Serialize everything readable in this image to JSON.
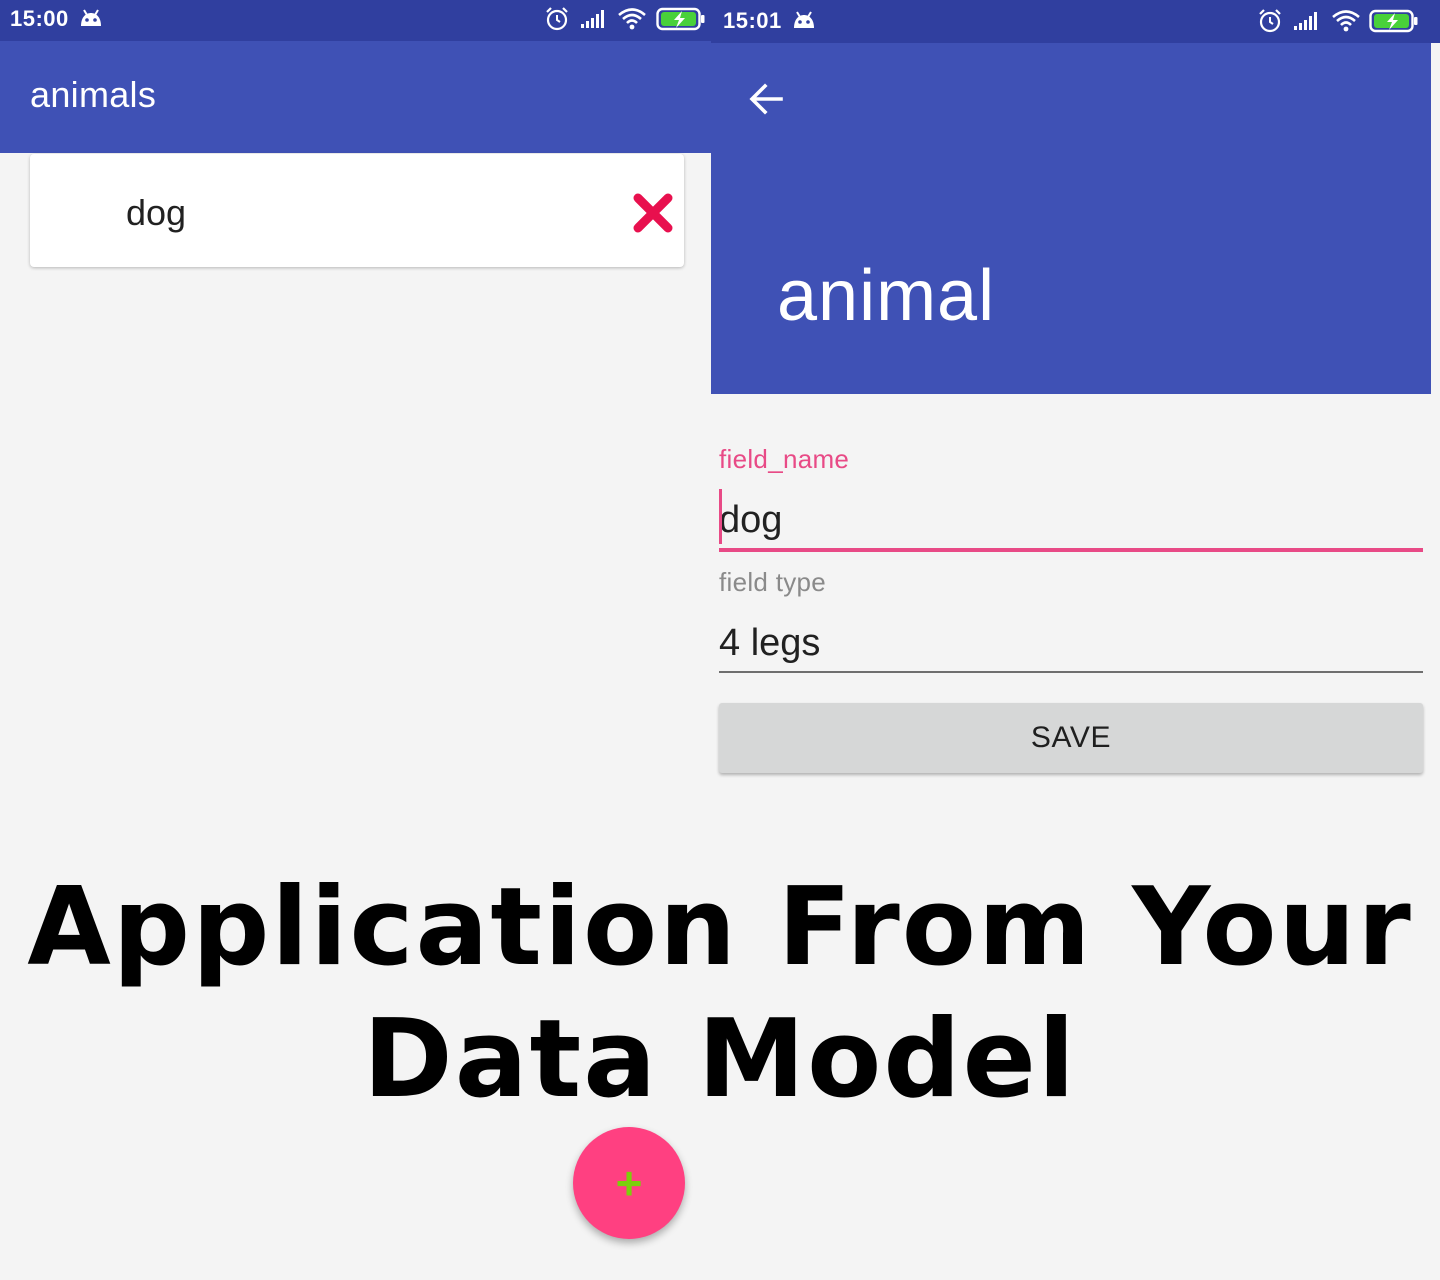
{
  "left_screen": {
    "status_bar": {
      "time": "15:00"
    },
    "app_bar": {
      "title": "animals"
    },
    "list": {
      "items": [
        {
          "label": "dog"
        }
      ]
    },
    "fab": {
      "label": "+"
    }
  },
  "right_screen": {
    "status_bar": {
      "time": "15:01"
    },
    "app_bar": {
      "title": "animal"
    },
    "form": {
      "name_field": {
        "label": "field_name",
        "value": "dog"
      },
      "type_field": {
        "label": "field type",
        "value": "4 legs"
      },
      "save_label": "SAVE"
    }
  },
  "caption": {
    "line1": "Application From Your",
    "line2": "Data Model"
  },
  "icons": {
    "status_left": [
      "android-icon",
      "alarm-icon",
      "signal-icon",
      "wifi-icon",
      "battery-charging-icon"
    ],
    "back": "back-arrow-icon",
    "delete": "delete-x-icon"
  },
  "colors": {
    "primary": "#3f51b5",
    "primary_dark": "#303f9f",
    "accent": "#ff4081",
    "field_focus": "#e84a86",
    "delete": "#e8104e",
    "fab_plus": "#7bd00b"
  }
}
